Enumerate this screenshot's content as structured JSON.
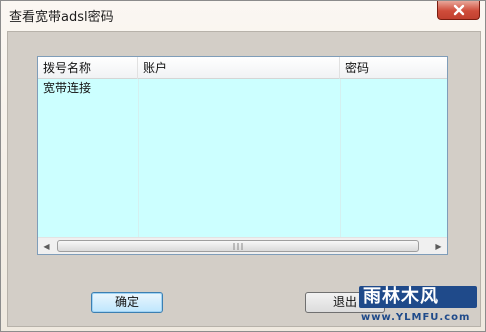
{
  "window": {
    "title": "查看宽带adsl密码"
  },
  "close": {
    "icon": "close-icon"
  },
  "list": {
    "columns": [
      "拨号名称",
      "账户",
      "密码"
    ],
    "rows": [
      {
        "name": "宽带连接",
        "account": "",
        "password": ""
      }
    ],
    "scroll": {
      "left_arrow": "◀",
      "right_arrow": "▶"
    }
  },
  "buttons": {
    "ok": "确定",
    "exit": "退出"
  },
  "watermark": {
    "logo": "雨林木风",
    "url": "www.YLMFU.com"
  }
}
